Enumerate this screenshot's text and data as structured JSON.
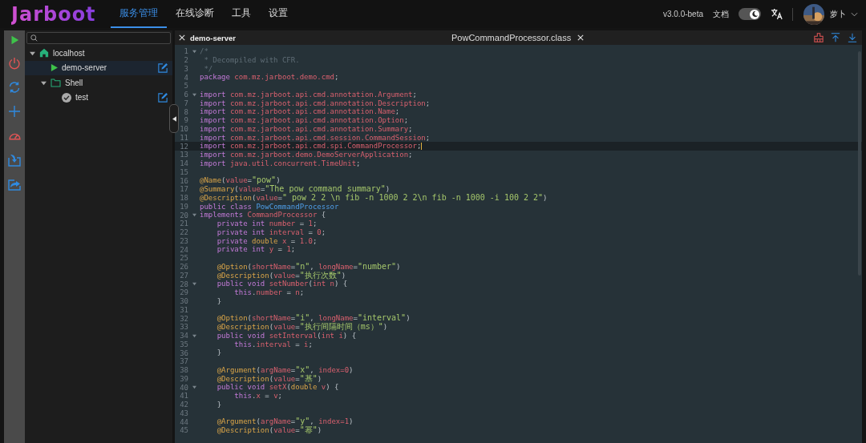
{
  "header": {
    "logo": "Jarboot",
    "nav": [
      {
        "label": "服务管理",
        "selected": true
      },
      {
        "label": "在线诊断",
        "selected": false
      },
      {
        "label": "工具",
        "selected": false
      },
      {
        "label": "设置",
        "selected": false
      }
    ],
    "version": "v3.0.0-beta",
    "docs": "文档",
    "dark_mode": {
      "on": true
    },
    "user": "萝卜"
  },
  "tree": [
    {
      "label": "localhost",
      "kind": "host",
      "expanded": true,
      "selected": false,
      "children": [
        {
          "label": "demo-server",
          "kind": "service",
          "running": true,
          "selected": true
        },
        {
          "label": "Shell",
          "kind": "folder",
          "expanded": true,
          "selected": false,
          "children": [
            {
              "label": "test",
              "kind": "service",
              "running": false,
              "selected": false
            }
          ]
        }
      ]
    }
  ],
  "editor": {
    "server_tab": "demo-server",
    "file_tab": "PowCommandProcessor.class",
    "lines": [
      {
        "number": "1",
        "fold": true,
        "tokens": [
          {
            "kind": "comment",
            "text": "/*"
          }
        ]
      },
      {
        "number": "2",
        "tokens": [
          {
            "kind": "comment",
            "text": " * Decompiled with CFR."
          }
        ]
      },
      {
        "number": "3",
        "tokens": [
          {
            "kind": "comment",
            "text": " */"
          }
        ]
      },
      {
        "number": "4",
        "tokens": [
          {
            "kind": "keyword",
            "text": "package "
          },
          {
            "kind": "name",
            "text": "com.mz.jarboot.demo.cmd"
          },
          {
            "kind": "plain",
            "text": ";"
          }
        ]
      },
      {
        "number": "5"
      },
      {
        "number": "6",
        "fold": true,
        "tokens": [
          {
            "kind": "keyword",
            "text": "import "
          },
          {
            "kind": "name",
            "text": "com.mz.jarboot.api.cmd.annotation.Argument"
          },
          {
            "kind": "plain",
            "text": ";"
          }
        ]
      },
      {
        "number": "7",
        "tokens": [
          {
            "kind": "keyword",
            "text": "import "
          },
          {
            "kind": "name",
            "text": "com.mz.jarboot.api.cmd.annotation.Description"
          },
          {
            "kind": "plain",
            "text": ";"
          }
        ]
      },
      {
        "number": "8",
        "tokens": [
          {
            "kind": "keyword",
            "text": "import "
          },
          {
            "kind": "name",
            "text": "com.mz.jarboot.api.cmd.annotation.Name"
          },
          {
            "kind": "plain",
            "text": ";"
          }
        ]
      },
      {
        "number": "9",
        "tokens": [
          {
            "kind": "keyword",
            "text": "import "
          },
          {
            "kind": "name",
            "text": "com.mz.jarboot.api.cmd.annotation.Option"
          },
          {
            "kind": "plain",
            "text": ";"
          }
        ]
      },
      {
        "number": "10",
        "tokens": [
          {
            "kind": "keyword",
            "text": "import "
          },
          {
            "kind": "name",
            "text": "com.mz.jarboot.api.cmd.annotation.Summary"
          },
          {
            "kind": "plain",
            "text": ";"
          }
        ]
      },
      {
        "number": "11",
        "tokens": [
          {
            "kind": "keyword",
            "text": "import "
          },
          {
            "kind": "name",
            "text": "com.mz.jarboot.api.cmd.session.CommandSession"
          },
          {
            "kind": "plain",
            "text": ";"
          }
        ]
      },
      {
        "number": "12",
        "current": true,
        "tokens": [
          {
            "kind": "keyword",
            "text": "import "
          },
          {
            "kind": "name",
            "text": "com.mz.jarboot.api.cmd.spi.CommandProcessor"
          },
          {
            "kind": "plain",
            "text": ";"
          }
        ]
      },
      {
        "number": "13",
        "tokens": [
          {
            "kind": "keyword",
            "text": "import "
          },
          {
            "kind": "name",
            "text": "com.mz.jarboot.demo.DemoServerApplication"
          },
          {
            "kind": "plain",
            "text": ";"
          }
        ]
      },
      {
        "number": "14",
        "tokens": [
          {
            "kind": "keyword",
            "text": "import "
          },
          {
            "kind": "name",
            "text": "java.util.concurrent.TimeUnit"
          },
          {
            "kind": "plain",
            "text": ";"
          }
        ]
      },
      {
        "number": "15"
      },
      {
        "number": "16",
        "tokens": [
          {
            "kind": "annotation",
            "text": "@Name"
          },
          {
            "kind": "plain",
            "text": "("
          },
          {
            "kind": "name",
            "text": "value"
          },
          {
            "kind": "plain",
            "text": "="
          },
          {
            "kind": "string",
            "text": "\"pow\""
          },
          {
            "kind": "plain",
            "text": ")"
          }
        ]
      },
      {
        "number": "17",
        "tokens": [
          {
            "kind": "annotation",
            "text": "@Summary"
          },
          {
            "kind": "plain",
            "text": "("
          },
          {
            "kind": "name",
            "text": "value"
          },
          {
            "kind": "plain",
            "text": "="
          },
          {
            "kind": "string",
            "text": "\"The pow command summary\""
          },
          {
            "kind": "plain",
            "text": ")"
          }
        ]
      },
      {
        "number": "18",
        "tokens": [
          {
            "kind": "annotation",
            "text": "@Description"
          },
          {
            "kind": "plain",
            "text": "("
          },
          {
            "kind": "name",
            "text": "value"
          },
          {
            "kind": "plain",
            "text": "="
          },
          {
            "kind": "string",
            "text": "\" pow 2 2 \\n fib -n 1000 2 2\\n fib -n 1000 -i 100 2 2\""
          },
          {
            "kind": "plain",
            "text": ")"
          }
        ]
      },
      {
        "number": "19",
        "tokens": [
          {
            "kind": "keyword",
            "text": "public class "
          },
          {
            "kind": "type",
            "text": "PowCommandProcessor"
          }
        ]
      },
      {
        "number": "20",
        "fold": true,
        "tokens": [
          {
            "kind": "keyword",
            "text": "implements "
          },
          {
            "kind": "name",
            "text": "CommandProcessor"
          },
          {
            "kind": "plain",
            "text": " {"
          }
        ]
      },
      {
        "number": "21",
        "tokens": [
          {
            "kind": "keyword",
            "text": "    private int "
          },
          {
            "kind": "name",
            "text": "number"
          },
          {
            "kind": "plain",
            "text": " = "
          },
          {
            "kind": "name",
            "text": "1"
          },
          {
            "kind": "plain",
            "text": ";"
          }
        ]
      },
      {
        "number": "22",
        "tokens": [
          {
            "kind": "keyword",
            "text": "    private int "
          },
          {
            "kind": "name",
            "text": "interval"
          },
          {
            "kind": "plain",
            "text": " = "
          },
          {
            "kind": "name",
            "text": "0"
          },
          {
            "kind": "plain",
            "text": ";"
          }
        ]
      },
      {
        "number": "23",
        "tokens": [
          {
            "kind": "keyword",
            "text": "    private "
          },
          {
            "kind": "annotation",
            "text": "double "
          },
          {
            "kind": "name",
            "text": "x"
          },
          {
            "kind": "plain",
            "text": " = "
          },
          {
            "kind": "name",
            "text": "1.0"
          },
          {
            "kind": "plain",
            "text": ";"
          }
        ]
      },
      {
        "number": "24",
        "tokens": [
          {
            "kind": "keyword",
            "text": "    private int "
          },
          {
            "kind": "name",
            "text": "y"
          },
          {
            "kind": "plain",
            "text": " = "
          },
          {
            "kind": "name",
            "text": "1"
          },
          {
            "kind": "plain",
            "text": ";"
          }
        ]
      },
      {
        "number": "25"
      },
      {
        "number": "26",
        "tokens": [
          {
            "kind": "annotation",
            "text": "    @Option"
          },
          {
            "kind": "plain",
            "text": "("
          },
          {
            "kind": "name",
            "text": "shortName"
          },
          {
            "kind": "plain",
            "text": "="
          },
          {
            "kind": "string",
            "text": "\"n\""
          },
          {
            "kind": "plain",
            "text": ", "
          },
          {
            "kind": "name",
            "text": "longName"
          },
          {
            "kind": "plain",
            "text": "="
          },
          {
            "kind": "string",
            "text": "\"number\""
          },
          {
            "kind": "plain",
            "text": ")"
          }
        ]
      },
      {
        "number": "27",
        "tokens": [
          {
            "kind": "annotation",
            "text": "    @Description"
          },
          {
            "kind": "plain",
            "text": "("
          },
          {
            "kind": "name",
            "text": "value"
          },
          {
            "kind": "plain",
            "text": "="
          },
          {
            "kind": "string",
            "text": "\"执行次数\""
          },
          {
            "kind": "plain",
            "text": ")"
          }
        ]
      },
      {
        "number": "28",
        "fold": true,
        "tokens": [
          {
            "kind": "keyword",
            "text": "    public void "
          },
          {
            "kind": "name",
            "text": "setNumber"
          },
          {
            "kind": "plain",
            "text": "("
          },
          {
            "kind": "name",
            "text": "int n"
          },
          {
            "kind": "plain",
            "text": ") {"
          }
        ]
      },
      {
        "number": "29",
        "tokens": [
          {
            "kind": "keyword",
            "text": "        this"
          },
          {
            "kind": "plain",
            "text": "."
          },
          {
            "kind": "name",
            "text": "number"
          },
          {
            "kind": "plain",
            "text": " = "
          },
          {
            "kind": "name",
            "text": "n"
          },
          {
            "kind": "plain",
            "text": ";"
          }
        ]
      },
      {
        "number": "30",
        "tokens": [
          {
            "kind": "plain",
            "text": "    }"
          }
        ]
      },
      {
        "number": "31"
      },
      {
        "number": "32",
        "tokens": [
          {
            "kind": "annotation",
            "text": "    @Option"
          },
          {
            "kind": "plain",
            "text": "("
          },
          {
            "kind": "name",
            "text": "shortName"
          },
          {
            "kind": "plain",
            "text": "="
          },
          {
            "kind": "string",
            "text": "\"i\""
          },
          {
            "kind": "plain",
            "text": ", "
          },
          {
            "kind": "name",
            "text": "longName"
          },
          {
            "kind": "plain",
            "text": "="
          },
          {
            "kind": "string",
            "text": "\"interval\""
          },
          {
            "kind": "plain",
            "text": ")"
          }
        ]
      },
      {
        "number": "33",
        "tokens": [
          {
            "kind": "annotation",
            "text": "    @Description"
          },
          {
            "kind": "plain",
            "text": "("
          },
          {
            "kind": "name",
            "text": "value"
          },
          {
            "kind": "plain",
            "text": "="
          },
          {
            "kind": "string",
            "text": "\"执行间隔时间（ms）\""
          },
          {
            "kind": "plain",
            "text": ")"
          }
        ]
      },
      {
        "number": "34",
        "fold": true,
        "tokens": [
          {
            "kind": "keyword",
            "text": "    public void "
          },
          {
            "kind": "name",
            "text": "setInterval"
          },
          {
            "kind": "plain",
            "text": "("
          },
          {
            "kind": "name",
            "text": "int i"
          },
          {
            "kind": "plain",
            "text": ") {"
          }
        ]
      },
      {
        "number": "35",
        "tokens": [
          {
            "kind": "keyword",
            "text": "        this"
          },
          {
            "kind": "plain",
            "text": "."
          },
          {
            "kind": "name",
            "text": "interval"
          },
          {
            "kind": "plain",
            "text": " = "
          },
          {
            "kind": "name",
            "text": "i"
          },
          {
            "kind": "plain",
            "text": ";"
          }
        ]
      },
      {
        "number": "36",
        "tokens": [
          {
            "kind": "plain",
            "text": "    }"
          }
        ]
      },
      {
        "number": "37"
      },
      {
        "number": "38",
        "tokens": [
          {
            "kind": "annotation",
            "text": "    @Argument"
          },
          {
            "kind": "plain",
            "text": "("
          },
          {
            "kind": "name",
            "text": "argName"
          },
          {
            "kind": "plain",
            "text": "="
          },
          {
            "kind": "string",
            "text": "\"x\""
          },
          {
            "kind": "plain",
            "text": ", "
          },
          {
            "kind": "name",
            "text": "index=0"
          },
          {
            "kind": "plain",
            "text": ")"
          }
        ]
      },
      {
        "number": "39",
        "tokens": [
          {
            "kind": "annotation",
            "text": "    @Description"
          },
          {
            "kind": "plain",
            "text": "("
          },
          {
            "kind": "name",
            "text": "value"
          },
          {
            "kind": "plain",
            "text": "="
          },
          {
            "kind": "string",
            "text": "\"基\""
          },
          {
            "kind": "plain",
            "text": ")"
          }
        ]
      },
      {
        "number": "40",
        "fold": true,
        "tokens": [
          {
            "kind": "keyword",
            "text": "    public void "
          },
          {
            "kind": "name",
            "text": "setX"
          },
          {
            "kind": "plain",
            "text": "("
          },
          {
            "kind": "annotation",
            "text": "double "
          },
          {
            "kind": "name",
            "text": "v"
          },
          {
            "kind": "plain",
            "text": ") {"
          }
        ]
      },
      {
        "number": "41",
        "tokens": [
          {
            "kind": "keyword",
            "text": "        this"
          },
          {
            "kind": "plain",
            "text": "."
          },
          {
            "kind": "name",
            "text": "x"
          },
          {
            "kind": "plain",
            "text": " = "
          },
          {
            "kind": "name",
            "text": "v"
          },
          {
            "kind": "plain",
            "text": ";"
          }
        ]
      },
      {
        "number": "42",
        "tokens": [
          {
            "kind": "plain",
            "text": "    }"
          }
        ]
      },
      {
        "number": "43"
      },
      {
        "number": "44",
        "tokens": [
          {
            "kind": "annotation",
            "text": "    @Argument"
          },
          {
            "kind": "plain",
            "text": "("
          },
          {
            "kind": "name",
            "text": "argName"
          },
          {
            "kind": "plain",
            "text": "="
          },
          {
            "kind": "string",
            "text": "\"y\""
          },
          {
            "kind": "plain",
            "text": ", "
          },
          {
            "kind": "name",
            "text": "index=1"
          },
          {
            "kind": "plain",
            "text": ")"
          }
        ]
      },
      {
        "number": "45",
        "tokens": [
          {
            "kind": "annotation",
            "text": "    @Description"
          },
          {
            "kind": "plain",
            "text": "("
          },
          {
            "kind": "name",
            "text": "value"
          },
          {
            "kind": "plain",
            "text": "="
          },
          {
            "kind": "string",
            "text": "\"幂\""
          },
          {
            "kind": "plain",
            "text": ")"
          }
        ]
      }
    ]
  }
}
